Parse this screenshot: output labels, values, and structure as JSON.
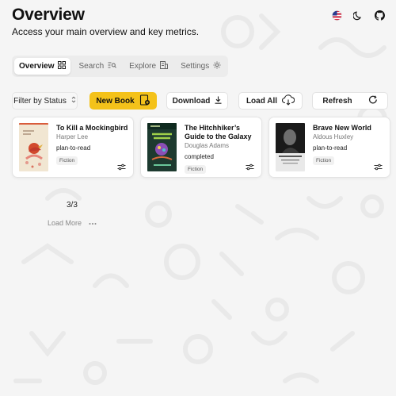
{
  "header": {
    "title": "Overview",
    "subtitle": "Access your main overview and key metrics."
  },
  "top_icons": [
    "us-flag-icon",
    "moon-icon",
    "github-icon"
  ],
  "tabs": [
    {
      "label": "Overview",
      "icon": "grid-icon",
      "active": true
    },
    {
      "label": "Search",
      "icon": "search-list-icon",
      "active": false
    },
    {
      "label": "Explore",
      "icon": "explore-icon",
      "active": false
    },
    {
      "label": "Settings",
      "icon": "gear-icon",
      "active": false
    }
  ],
  "toolbar": {
    "filter_label": "Filter by Status",
    "new_book_label": "New Book",
    "download_label": "Download",
    "load_all_label": "Load All",
    "refresh_label": "Refresh"
  },
  "books": [
    {
      "title": "To Kill a Mockingbird",
      "author": "Harper Lee",
      "status": "plan-to-read",
      "genre": "Fiction"
    },
    {
      "title": "The Hitchhiker’s Guide to the Galaxy",
      "author": "Douglas Adams",
      "status": "completed",
      "genre": "Fiction"
    },
    {
      "title": "Brave New World",
      "author": "Aldous Huxley",
      "status": "plan-to-read",
      "genre": "Fiction"
    }
  ],
  "pagination": {
    "text": "3/3",
    "load_more_label": "Load More"
  },
  "colors": {
    "accent": "#f4c21a",
    "background": "#f5f5f5"
  }
}
